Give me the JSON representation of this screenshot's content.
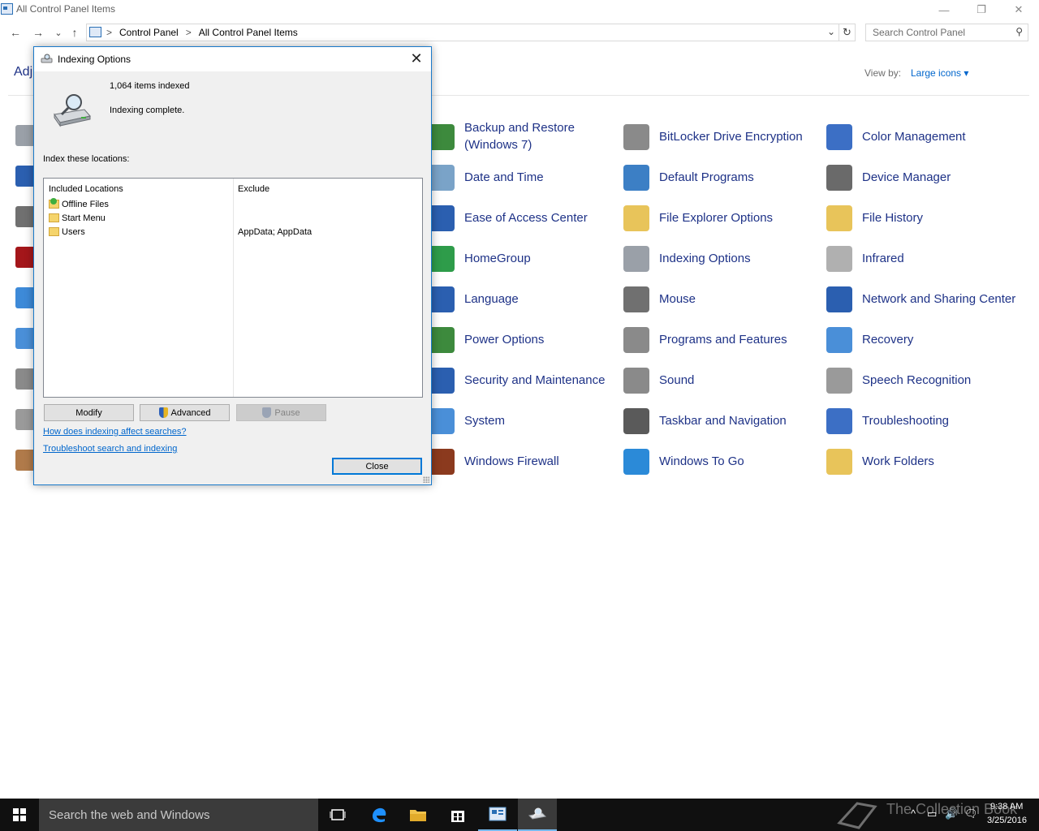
{
  "window": {
    "title": "All Control Panel Items",
    "minimize_glyph": "—",
    "restore_glyph": "❐",
    "close_glyph": "✕"
  },
  "nav": {
    "back_glyph": "←",
    "forward_glyph": "→",
    "recent_glyph": "⌄",
    "up_glyph": "↑"
  },
  "address": {
    "crumbs": [
      "Control Panel",
      "All Control Panel Items"
    ],
    "separator": ">",
    "dropdown_glyph": "⌄",
    "refresh_glyph": "↻"
  },
  "search": {
    "placeholder": "Search Control Panel",
    "icon": "search-icon",
    "glyph": "⚲"
  },
  "header": {
    "adjust_partial": "Adj",
    "view_by_label": "View by:",
    "view_by_value": "Large icons ▾"
  },
  "cp_items": [
    {
      "label": "Backup and Restore (Windows 7)",
      "icon": "backup-restore-icon",
      "color": "#3d8a3d"
    },
    {
      "label": "BitLocker Drive Encryption",
      "icon": "bitlocker-icon",
      "color": "#8a8a8a"
    },
    {
      "label": "Color Management",
      "icon": "color-management-icon",
      "color": "#3c6fc5"
    },
    {
      "label": "Date and Time",
      "icon": "date-time-icon",
      "color": "#7aa3c8"
    },
    {
      "label": "Default Programs",
      "icon": "default-programs-icon",
      "color": "#3c7fc5"
    },
    {
      "label": "Device Manager",
      "icon": "device-manager-icon",
      "color": "#6a6a6a"
    },
    {
      "label": "Ease of Access Center",
      "icon": "ease-of-access-icon",
      "color": "#2b5fb0"
    },
    {
      "label": "File Explorer Options",
      "icon": "file-explorer-options-icon",
      "color": "#e8c45a"
    },
    {
      "label": "File History",
      "icon": "file-history-icon",
      "color": "#e8c45a"
    },
    {
      "label": "HomeGroup",
      "icon": "homegroup-icon",
      "color": "#2e9c4a"
    },
    {
      "label": "Indexing Options",
      "icon": "indexing-options-icon",
      "color": "#9aa0a8"
    },
    {
      "label": "Infrared",
      "icon": "infrared-icon",
      "color": "#b0b0b0"
    },
    {
      "label": "Language",
      "icon": "language-icon",
      "color": "#2b5fb0"
    },
    {
      "label": "Mouse",
      "icon": "mouse-icon",
      "color": "#707070"
    },
    {
      "label": "Network and Sharing Center",
      "icon": "network-sharing-icon",
      "color": "#2b5fb0"
    },
    {
      "label": "Power Options",
      "icon": "power-options-icon",
      "color": "#3d8a3d"
    },
    {
      "label": "Programs and Features",
      "icon": "programs-features-icon",
      "color": "#8a8a8a"
    },
    {
      "label": "Recovery",
      "icon": "recovery-icon",
      "color": "#4a8fd8"
    },
    {
      "label": "Security and Maintenance",
      "icon": "security-maintenance-icon",
      "color": "#2b5fb0"
    },
    {
      "label": "Sound",
      "icon": "sound-icon",
      "color": "#8a8a8a"
    },
    {
      "label": "Speech Recognition",
      "icon": "speech-recognition-icon",
      "color": "#9a9a9a"
    },
    {
      "label": "System",
      "icon": "system-icon",
      "color": "#4a8fd8"
    },
    {
      "label": "Taskbar and Navigation",
      "icon": "taskbar-navigation-icon",
      "color": "#5a5a5a"
    },
    {
      "label": "Troubleshooting",
      "icon": "troubleshooting-icon",
      "color": "#3c6fc5"
    },
    {
      "label": "Windows Firewall",
      "icon": "windows-firewall-icon",
      "color": "#8b3a1e"
    },
    {
      "label": "Windows To Go",
      "icon": "windows-to-go-icon",
      "color": "#2b8ad8"
    },
    {
      "label": "Work Folders",
      "icon": "work-folders-icon",
      "color": "#e8c45a"
    }
  ],
  "dialog": {
    "title": "Indexing Options",
    "close_glyph": "✕",
    "items_indexed": "1,064 items indexed",
    "status": "Indexing complete.",
    "index_locations_label": "Index these locations:",
    "columns": [
      "Included Locations",
      "Exclude"
    ],
    "rows": [
      {
        "name": "Offline Files",
        "exclude": ""
      },
      {
        "name": "Start Menu",
        "exclude": ""
      },
      {
        "name": "Users",
        "exclude": "AppData; AppData"
      }
    ],
    "buttons": {
      "modify": "Modify",
      "advanced": "Advanced",
      "pause": "Pause",
      "close": "Close"
    },
    "links": {
      "how_affect": "How does indexing affect searches?",
      "troubleshoot": "Troubleshoot search and indexing"
    }
  },
  "taskbar": {
    "search_placeholder": "Search the web and Windows",
    "watermark": "The Collection Book",
    "time": "9:38 AM",
    "date": "3/25/2016",
    "tray_chevron": "^",
    "tray_glyphs": [
      "▭",
      "🔊",
      "🗨"
    ]
  }
}
